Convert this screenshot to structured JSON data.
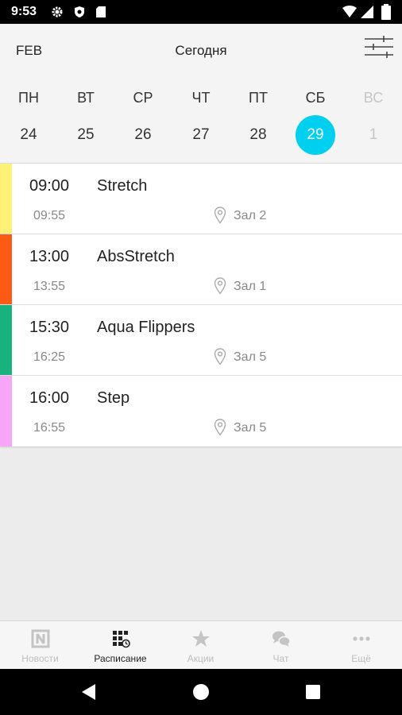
{
  "status_bar": {
    "time": "9:53",
    "icons": [
      "gear-icon",
      "shield-icon",
      "sd-card-icon",
      "wifi-icon",
      "signal-icon",
      "battery-icon"
    ]
  },
  "header": {
    "month": "FEB",
    "today_label": "Сегодня",
    "filter_icon": "sliders-icon",
    "weekdays": [
      "ПН",
      "ВТ",
      "СР",
      "ЧТ",
      "ПТ",
      "СБ",
      "ВС"
    ],
    "dates": [
      "24",
      "25",
      "26",
      "27",
      "28",
      "29",
      "1"
    ],
    "selected_index": 5,
    "accent_color": "#00d0f0"
  },
  "classes": [
    {
      "start": "09:00",
      "end": "09:55",
      "title": "Stretch",
      "room": "Зал 2",
      "color": "#fff176"
    },
    {
      "start": "13:00",
      "end": "13:55",
      "title": "AbsStretch",
      "room": "Зал 1",
      "color": "#ff5a14"
    },
    {
      "start": "15:30",
      "end": "16:25",
      "title": "Aqua Flippers",
      "room": "Зал 5",
      "color": "#17b27d"
    },
    {
      "start": "16:00",
      "end": "16:55",
      "title": "Step",
      "room": "Зал 5",
      "color": "#f7a6f7"
    }
  ],
  "bottom_nav": {
    "active_index": 1,
    "items": [
      {
        "label": "Новости",
        "icon": "news-icon"
      },
      {
        "label": "Расписание",
        "icon": "schedule-icon"
      },
      {
        "label": "Акции",
        "icon": "star-icon"
      },
      {
        "label": "Чат",
        "icon": "chat-icon"
      },
      {
        "label": "Ещё",
        "icon": "more-icon"
      }
    ]
  },
  "system_nav": {
    "icons": [
      "back-icon",
      "home-icon",
      "recents-icon"
    ]
  }
}
